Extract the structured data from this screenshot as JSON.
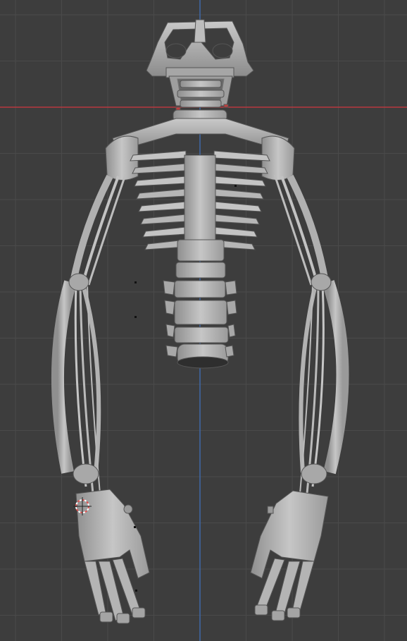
{
  "viewport": {
    "background": "#3d3d3d",
    "grid_line_color": "#4a4a4a",
    "x_axis_color": "#b8383f",
    "y_axis_color": "#3f68a8",
    "model_fill": "#b2b2b2",
    "model_shade": "#8a8a8a",
    "model_highlight": "#d8d8d8",
    "edge_color": "#4a4a4a"
  },
  "scene": {
    "object": "robotic-skeleton-mesh",
    "parts": [
      "skull-frame",
      "neck-vertebrae",
      "clavicles",
      "rib-cage",
      "spine-column",
      "left-arm",
      "right-arm",
      "left-hand",
      "right-hand"
    ],
    "cursor_icon": "3d-cursor-icon"
  }
}
